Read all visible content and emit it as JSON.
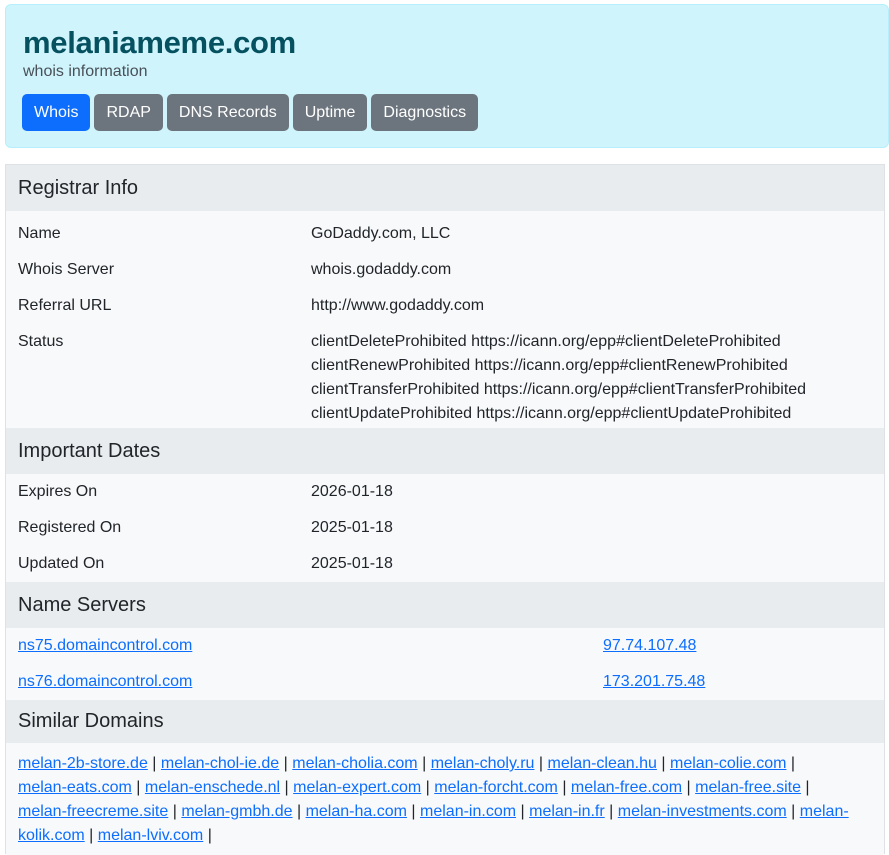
{
  "header": {
    "domain": "melaniameme.com",
    "subtitle": "whois information",
    "tabs": [
      "Whois",
      "RDAP",
      "DNS Records",
      "Uptime",
      "Diagnostics"
    ],
    "active_tab": "Whois"
  },
  "registrar": {
    "heading": "Registrar Info",
    "name_label": "Name",
    "name": "GoDaddy.com, LLC",
    "whois_label": "Whois Server",
    "whois": "whois.godaddy.com",
    "referral_label": "Referral URL",
    "referral": "http://www.godaddy.com",
    "status_label": "Status",
    "status": [
      "clientDeleteProhibited https://icann.org/epp#clientDeleteProhibited",
      "clientRenewProhibited https://icann.org/epp#clientRenewProhibited",
      "clientTransferProhibited https://icann.org/epp#clientTransferProhibited",
      "clientUpdateProhibited https://icann.org/epp#clientUpdateProhibited"
    ]
  },
  "dates": {
    "heading": "Important Dates",
    "expires_label": "Expires On",
    "expires": "2026-01-18",
    "registered_label": "Registered On",
    "registered": "2025-01-18",
    "updated_label": "Updated On",
    "updated": "2025-01-18"
  },
  "nameservers": {
    "heading": "Name Servers",
    "items": [
      {
        "host": "ns75.domaincontrol.com",
        "ip": "97.74.107.48"
      },
      {
        "host": "ns76.domaincontrol.com",
        "ip": "173.201.75.48"
      }
    ]
  },
  "similar": {
    "heading": "Similar Domains",
    "line1": [
      "melan-2b-store.de",
      "melan-chol-ie.de",
      "melan-cholia.com",
      "melan-choly.ru",
      "melan-clean.hu",
      "melan-colie.com"
    ],
    "line2": [
      "melan-eats.com",
      "melan-enschede.nl",
      "melan-expert.com",
      "melan-forcht.com",
      "melan-free.com",
      "melan-free.site"
    ],
    "line3": [
      "melan-freecreme.site",
      "melan-gmbh.de",
      "melan-ha.com",
      "melan-in.com",
      "melan-in.fr",
      "melan-investments.com"
    ],
    "line3_tail": "melan-",
    "line4_head": "kolik.com",
    "line4": [
      "melan-lviv.com"
    ]
  }
}
